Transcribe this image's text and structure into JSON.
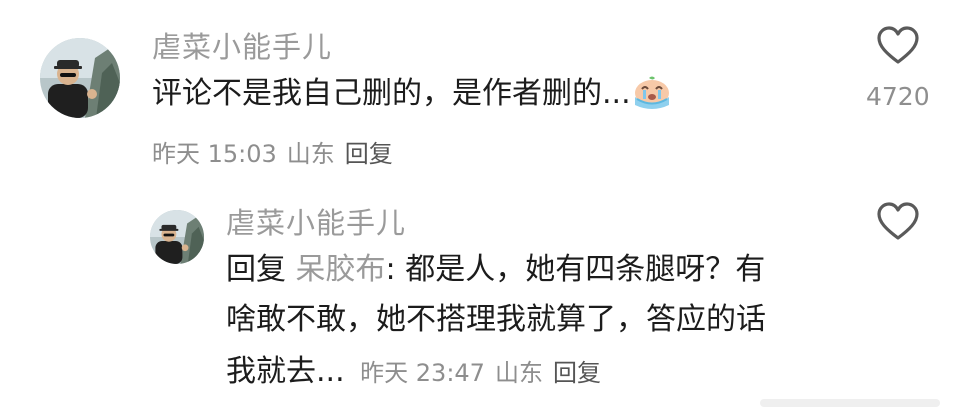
{
  "comments": [
    {
      "username": "虐菜小能手儿",
      "text": "评论不是我自己删的，是作者删的...",
      "emoji_icon": "crying-face-icon",
      "time": "昨天 15:03",
      "location": "山东",
      "reply_label": "回复",
      "like_count": "4720"
    }
  ],
  "reply": {
    "username": "虐菜小能手儿",
    "prefix": "回复",
    "reply_to": "呆胶布",
    "colon": ": ",
    "line1_text": "都是人，她有四条腿呀？有",
    "line2_text": "啥敢不敢，她不搭理我就算了，答应的话",
    "line3_text": "我就去...",
    "time": "昨天 23:47",
    "location": "山东",
    "reply_label": "回复"
  },
  "colors": {
    "username": "#9a9a9a",
    "text": "#1c1c1c",
    "meta": "#8e8e8e"
  }
}
